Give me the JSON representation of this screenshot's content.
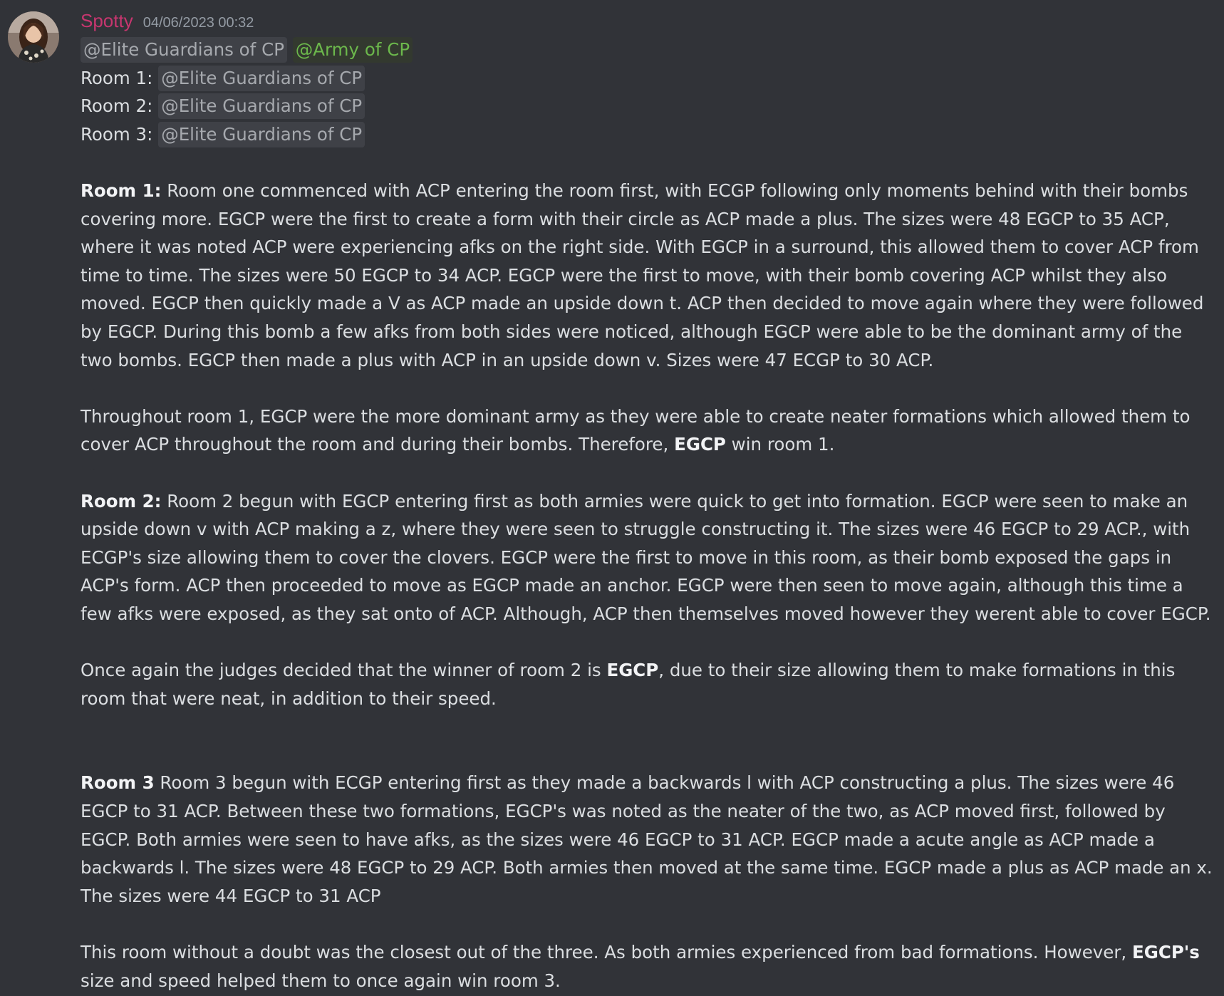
{
  "message": {
    "username": "Spotty",
    "timestamp": "04/06/2023 00:32",
    "mentions_line": [
      "@Elite Guardians of CP",
      "@Army of CP"
    ],
    "rooms": [
      {
        "label": "Room 1:",
        "mention": "@Elite Guardians of CP"
      },
      {
        "label": "Room 2:",
        "mention": "@Elite Guardians of CP"
      },
      {
        "label": "Room 3:",
        "mention": "@Elite Guardians of CP"
      }
    ],
    "room1": {
      "heading": "Room 1:",
      "lines": [
        " Room one commenced with ACP entering the room first, with ECGP following only moments behind with their bombs",
        "covering more. EGCP were the first to create a form with their circle as ACP made a plus. The sizes were 48 EGCP to 35 ACP,",
        "where it was noted ACP were experiencing afks on the right side. With EGCP in a surround, this allowed them to cover ACP from",
        "time to time. The sizes were 50 EGCP to 34 ACP. EGCP were the first to move, with their bomb covering ACP whilst they also",
        "moved. EGCP then quickly made a V as ACP made an upside down t. ACP then decided to move again where they were followed",
        "by EGCP. During this bomb a few afks from both sides were noticed, although EGCP were able to be the dominant army of the",
        "two bombs. EGCP then made a plus with ACP in an upside down v. Sizes were 47 ECGP to 30 ACP."
      ]
    },
    "room1_verdict": {
      "line1": "Throughout room 1, EGCP were the more dominant army as they were able to create neater formations which allowed them to",
      "line2_before": "cover ACP throughout the room and during their bombs. Therefore, ",
      "winner": "EGCP",
      "line2_after": " win room 1."
    },
    "room2": {
      "heading": "Room 2:",
      "lines": [
        " Room 2 begun with EGCP entering first as both armies were quick to get into formation. EGCP were seen to make an",
        "upside down v with ACP making a z, where they were seen to struggle constructing it. The sizes were 46 EGCP to 29 ACP., with",
        "ECGP's size allowing them to cover the clovers. EGCP were the first to move in this room, as their bomb exposed the gaps in",
        "ACP's form. ACP then proceeded to move as EGCP made an anchor.  EGCP were then seen to move again, although this time a",
        "few afks were exposed, as they sat onto of ACP. Although, ACP then themselves moved however they werent able to cover EGCP."
      ]
    },
    "room2_verdict": {
      "line1_before": "Once again the judges decided that the winner of room 2 is ",
      "winner": "EGCP",
      "line1_after": ", due to their size allowing them to make formations in this",
      "line2": "room that were neat, in addition to their speed."
    },
    "room3": {
      "heading": "Room 3",
      "lines": [
        " Room 3 begun with ECGP entering first as they made a backwards l with ACP constructing a plus. The sizes were 46",
        "EGCP to 31 ACP.  Between these two formations, EGCP's was noted as the neater of the two, as ACP moved first, followed by",
        "EGCP. Both armies were seen to have afks, as the sizes were 46 EGCP to 31 ACP.  EGCP made a acute angle as ACP made a",
        "backwards l. The sizes were 48 EGCP to 29 ACP. Both armies then moved at the same time. EGCP made a plus as ACP made an x.",
        "The sizes were 44 EGCP to 31 ACP"
      ]
    },
    "room3_verdict": {
      "line1_before": "This room without a doubt was the closest out of the three. As both armies experienced from bad formations. However, ",
      "winner": "EGCP's",
      "line2": "size and speed helped them to once again win room 3."
    }
  }
}
